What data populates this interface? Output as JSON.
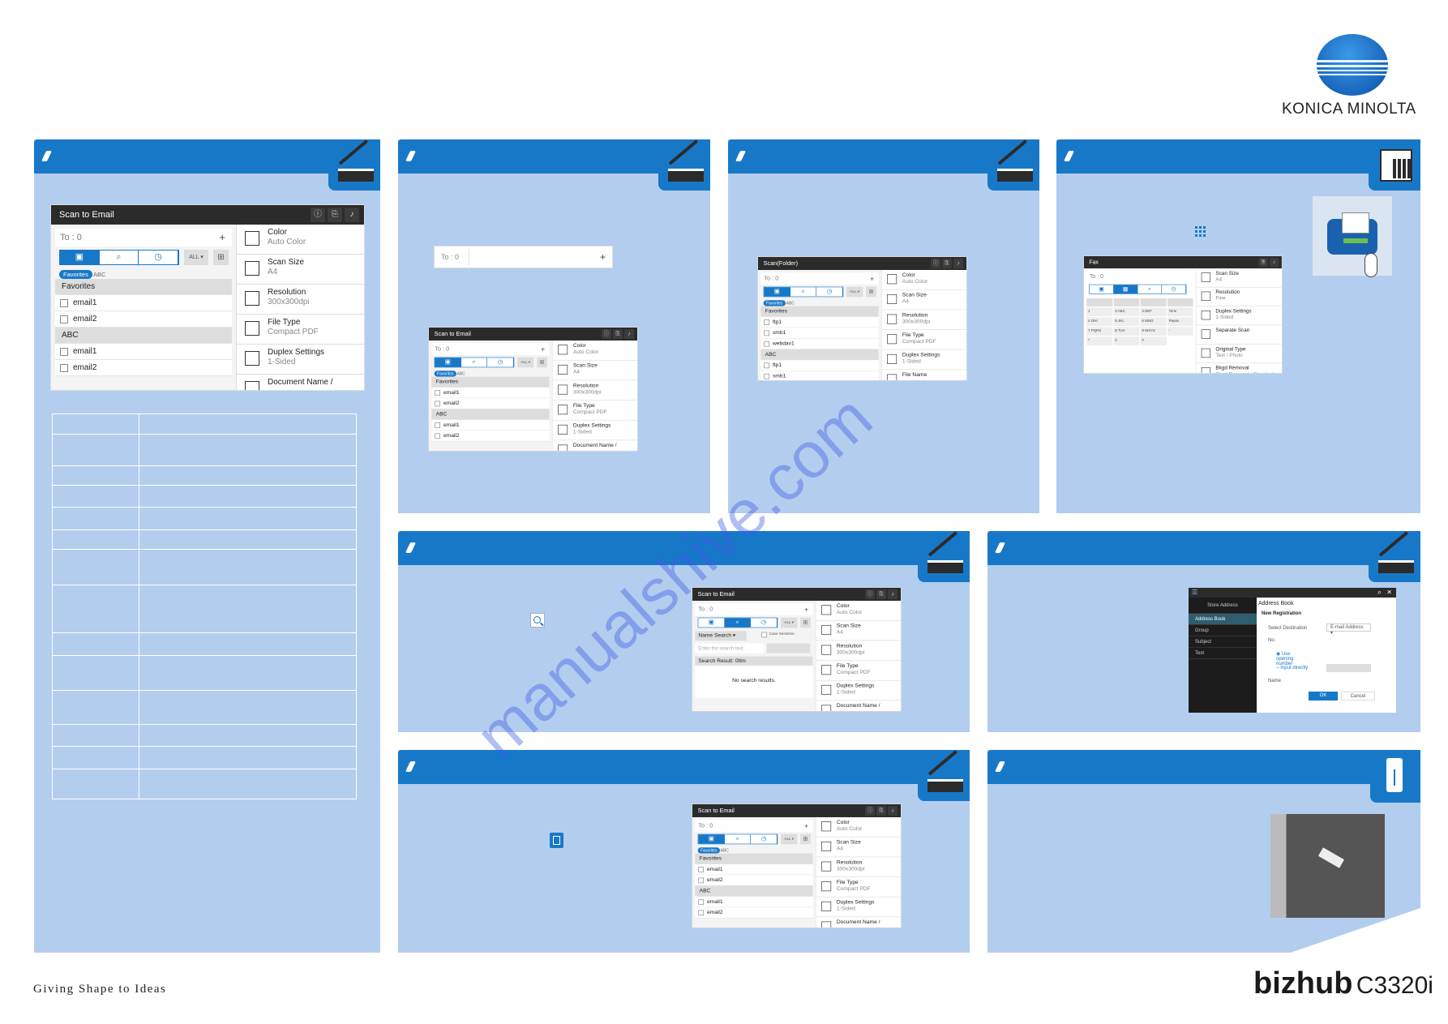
{
  "brand": {
    "company": "KONICA MINOLTA",
    "tagline": "Giving Shape to Ideas",
    "product": "bizhub",
    "model": "C3320i"
  },
  "watermark": "manualshive.com",
  "panel2": {
    "to_label": "To : 0",
    "plus": "+"
  },
  "screens": {
    "email": {
      "title": "Scan  to  Email",
      "to": "To : 0",
      "chips": [
        "Favorites",
        "ABC"
      ],
      "active_tab": 0,
      "list": [
        {
          "h": true,
          "t": "Favorites"
        },
        {
          "t": "email1"
        },
        {
          "t": "email2"
        },
        {
          "h": true,
          "t": "ABC"
        },
        {
          "t": "email1"
        },
        {
          "t": "email2"
        }
      ],
      "settings": [
        {
          "t": "Color",
          "s": "Auto  Color",
          "i": "color-icon"
        },
        {
          "t": "Scan  Size",
          "s": "A4",
          "i": "scan-size-icon"
        },
        {
          "t": "Resolution",
          "s": "300x300dpi",
          "i": "resolution-icon"
        },
        {
          "t": "File  Type",
          "s": "Compact  PDF",
          "i": "file-type-icon"
        },
        {
          "t": "Duplex  Settings",
          "s": "1-Sided",
          "i": "duplex-icon"
        },
        {
          "t": "Document  Name /",
          "s": "",
          "i": "document-icon"
        }
      ]
    },
    "folder": {
      "title": "Scan(Folder)",
      "to": "To : 0",
      "chips": [
        "Favorites",
        "ABC"
      ],
      "active_tab": 0,
      "list": [
        {
          "h": true,
          "t": "Favorites"
        },
        {
          "t": "ftp1"
        },
        {
          "t": "smb1"
        },
        {
          "t": "webdav1"
        },
        {
          "h": true,
          "t": "ABC"
        },
        {
          "t": "ftp1"
        },
        {
          "t": "smb1"
        }
      ],
      "settings": [
        {
          "t": "Color",
          "s": "Auto Color",
          "i": "color-icon"
        },
        {
          "t": "Scan Size",
          "s": "A4",
          "i": "scan-size-icon"
        },
        {
          "t": "Resolution",
          "s": "300x300dpi",
          "i": "resolution-icon"
        },
        {
          "t": "File Type",
          "s": "Compact PDF",
          "i": "file-type-icon"
        },
        {
          "t": "Duplex Settings",
          "s": "1-Sided",
          "i": "duplex-icon"
        },
        {
          "t": "File Name",
          "s": "",
          "i": "document-icon"
        }
      ]
    },
    "search": {
      "title": "Scan  to  Email",
      "to": "To : 0",
      "active_tab": 1,
      "search_mode": "Name Search",
      "case_sensitive": "Case Sensitive",
      "search_placeholder": "Enter the search text.",
      "result_label": "Search Result: 0Itm",
      "no_results": "No search results.",
      "settings": [
        {
          "t": "Color",
          "s": "Auto Color",
          "i": "color-icon"
        },
        {
          "t": "Scan  Size",
          "s": "A4",
          "i": "scan-size-icon"
        },
        {
          "t": "Resolution",
          "s": "300x300dpi",
          "i": "resolution-icon"
        },
        {
          "t": "File Type",
          "s": "Compact PDF",
          "i": "file-type-icon"
        },
        {
          "t": "Duplex Settings",
          "s": "1-Sided",
          "i": "duplex-icon"
        },
        {
          "t": "Document Name /",
          "s": "",
          "i": "document-icon"
        }
      ]
    },
    "fax": {
      "title": "Fax",
      "to": "To : 0",
      "keys": [
        "1",
        "2 ABC",
        "3 DEF",
        "Tone",
        "4 GHI",
        "5 JKL",
        "6 MNO",
        "Pause",
        "7 PQRS",
        "8 TUV",
        "9 WXYZ",
        "-",
        "*",
        "0",
        "#",
        ""
      ],
      "settings": [
        {
          "t": "Scan Size",
          "s": "A4",
          "i": "scan-size-icon"
        },
        {
          "t": "Resolution",
          "s": "Fine",
          "i": "resolution-icon"
        },
        {
          "t": "Duplex Settings",
          "s": "1-Sided",
          "i": "duplex-icon"
        },
        {
          "t": "Separate Scan",
          "s": "",
          "i": "separate-scan-icon"
        },
        {
          "t": "Original Type",
          "s": "Text / Photo",
          "i": "original-type-icon"
        },
        {
          "t": "Bkgd Removal",
          "s": "Bkgd Removal : Standard",
          "i": "bkgd-removal-icon"
        }
      ]
    },
    "address": {
      "back_title": "Store Address",
      "menu": [
        "Address Book",
        "Group",
        "Subject",
        "Text"
      ],
      "heading": "Address Book",
      "sub": "New Registration",
      "select_label": "Select Destination",
      "select_value": "E-mail Address",
      "no_label": "No.",
      "radio1": "Use opening number",
      "radio2": "Input directly",
      "name_label": "Name",
      "ok": "OK",
      "cancel": "Cancel"
    }
  },
  "colors": {
    "accent": "#1878c8",
    "panel_bg": "#b3cdee",
    "screen_title": "#2b2b2b"
  }
}
